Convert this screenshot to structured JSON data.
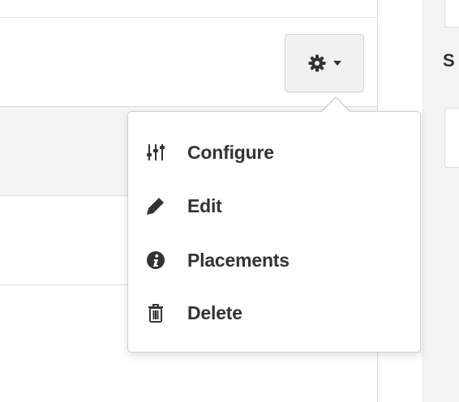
{
  "toolbar": {
    "settings_icon": "gear-icon",
    "dropdown_icon": "caret-down-icon"
  },
  "sidebar": {
    "heading": "S"
  },
  "menu": {
    "items": [
      {
        "label": "Configure",
        "icon": "sliders-icon"
      },
      {
        "label": "Edit",
        "icon": "pencil-icon"
      },
      {
        "label": "Placements",
        "icon": "info-circle-icon"
      },
      {
        "label": "Delete",
        "icon": "trash-icon"
      }
    ]
  },
  "colors": {
    "text": "#333333",
    "button_bg": "#f1f1f1",
    "border": "#d0d0d0",
    "row_gray": "#f5f5f5"
  }
}
